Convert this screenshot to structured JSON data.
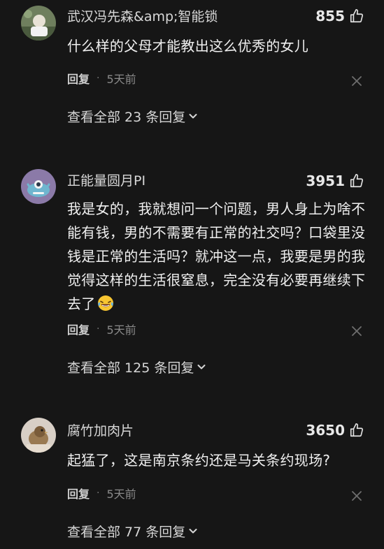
{
  "comments": [
    {
      "username": "武汉冯先森&amp;智能锁",
      "likes": "855",
      "text": "什么样的父母才能教出这么优秀的女儿",
      "reply_label": "回复",
      "separator": "·",
      "time": "5天前",
      "view_replies": "查看全部 23 条回复"
    },
    {
      "username": "正能量圆月PI",
      "likes": "3951",
      "text": "我是女的，我就想问一个问题，男人身上为啥不能有钱，男的不需要有正常的社交吗？口袋里没钱是正常的生活吗？就冲这一点，我要是男的我觉得这样的生活很窒息，完全没有必要再继续下去了",
      "emoji": "laughing-crying-emoji",
      "reply_label": "回复",
      "separator": "·",
      "time": "5天前",
      "view_replies": "查看全部 125 条回复"
    },
    {
      "username": "腐竹加肉片",
      "likes": "3650",
      "text": "起猛了，这是南京条约还是马关条约现场?",
      "reply_label": "回复",
      "separator": "·",
      "time": "5天前",
      "view_replies": "查看全部 77 条回复"
    }
  ],
  "icons": {
    "like": "thumbs-up-icon",
    "close": "close-icon",
    "expand": "chevron-down-icon"
  },
  "colors": {
    "background": "#161616",
    "text": "#f0f0f0",
    "muted": "#8a8a8a"
  }
}
